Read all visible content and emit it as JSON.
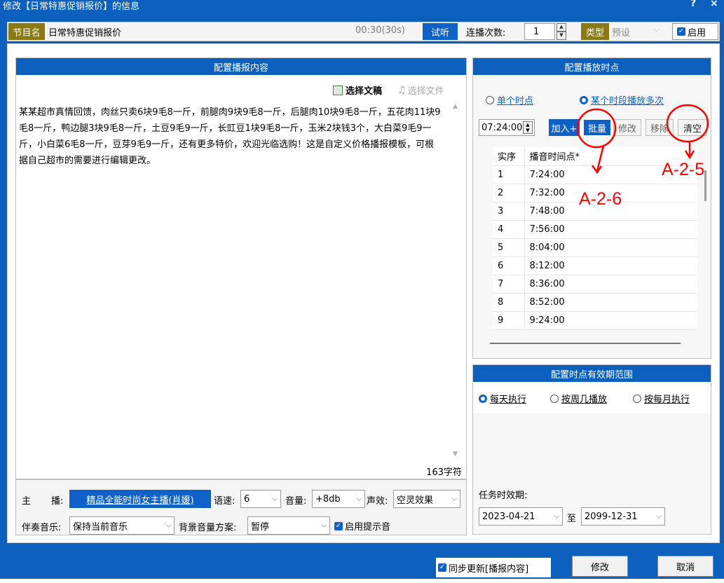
{
  "window": {
    "title": "修改【日常特惠促销报价】的信息",
    "help": "?",
    "close": "×"
  },
  "toolbar": {
    "program_label": "节目名",
    "program_name": "日常特惠促销报价",
    "duration": "00:30(30s)",
    "preview": "试听",
    "repeat_label": "连播次数:",
    "repeat_value": "1",
    "type_label": "类型",
    "type_value": "预设",
    "enable_label": "启用"
  },
  "left": {
    "header": "配置播报内容",
    "select_doc": "选择文稿",
    "select_file": "选择文件",
    "content": "某某超市真情回馈，肉丝只卖6块9毛8一斤，前腿肉9块9毛8一斤，后腿肉10块9毛8一斤，五花肉11块9毛8一斤，鸭边腿3块9毛8一斤，土豆9毛9一斤，长豇豆1块9毛8一斤，玉米2块钱3个，大白菜9毛9一斤，小白菜6毛8一斤，豆芽9毛9一斤，还有更多特价，欢迎光临选购！这是自定义价格播报模板，可根据自己超市的需要进行编辑更改。",
    "char_count": "163字符",
    "anchor_label1": "主",
    "anchor_label2": "播:",
    "anchor_value": "精品全能时尚女主播(肖媛)",
    "speed_label": "语速:",
    "speed_value": "6",
    "volume_label": "音量:",
    "volume_value": "+8db",
    "effect_label": "声效:",
    "effect_value": "空灵效果",
    "music_label": "伴奏音乐:",
    "music_value": "保持当前音乐",
    "bg_label": "背景音量方案:",
    "bg_value": "暂停",
    "prompt_label": "启用提示音"
  },
  "right": {
    "header": "配置播放时点",
    "mode_single": "单个时点",
    "mode_multi": "某个时段播放多次",
    "time_value": "07:24:00",
    "btn_add": "加入+",
    "btn_batch": "批量",
    "btn_modify": "修改",
    "btn_remove": "移除",
    "btn_clear": "清空",
    "col_index": "实序",
    "col_time": "播音时间点*",
    "rows": [
      {
        "i": "1",
        "t": "7:24:00"
      },
      {
        "i": "2",
        "t": "7:32:00"
      },
      {
        "i": "3",
        "t": "7:48:00"
      },
      {
        "i": "4",
        "t": "7:56:00"
      },
      {
        "i": "5",
        "t": "8:04:00"
      },
      {
        "i": "6",
        "t": "8:12:00"
      },
      {
        "i": "7",
        "t": "8:36:00"
      },
      {
        "i": "8",
        "t": "8:52:00"
      },
      {
        "i": "9",
        "t": "9:24:00"
      }
    ],
    "validity_header": "配置时点有效期范围",
    "daily": "每天执行",
    "weekly": "按周几播放",
    "monthly": "按每月执行",
    "task_label": "任务时效期:",
    "date_from": "2023-04-21",
    "date_to_label": "至",
    "date_to": "2099-12-31"
  },
  "annotations": {
    "a25": "A-2-5",
    "a26": "A-2-6"
  },
  "footer": {
    "sync": "同步更新[播报内容]",
    "modify": "修改",
    "cancel": "取消"
  }
}
